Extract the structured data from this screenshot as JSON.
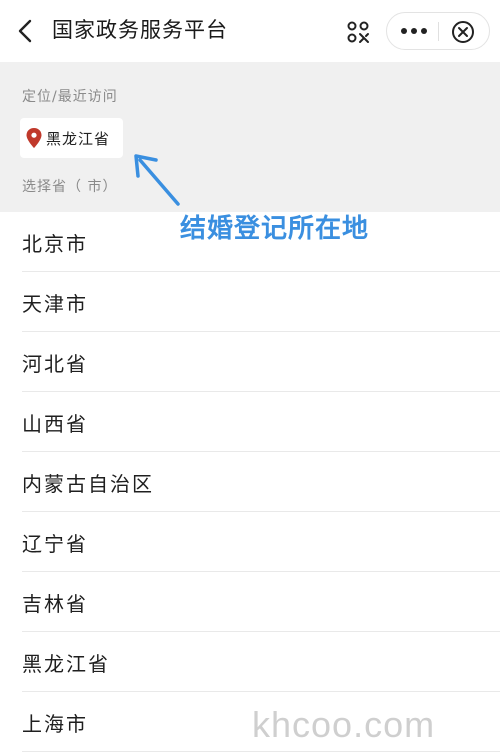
{
  "header": {
    "title": "国家政务服务平台",
    "back_icon": "chevron-left-icon",
    "scan_icon": "scan-icon",
    "more_icon": "more-dots-icon",
    "close_icon": "close-circle-icon"
  },
  "location": {
    "recent_label": "定位/最近访问",
    "current_province": "黑龙江省",
    "pin_color": "#c0392b",
    "select_label": "选择省（ 市）"
  },
  "annotation": {
    "text": "结婚登记所在地",
    "color": "#3a8fe0"
  },
  "provinces": [
    "北京市",
    "天津市",
    "河北省",
    "山西省",
    "内蒙古自治区",
    "辽宁省",
    "吉林省",
    "黑龙江省",
    "上海市"
  ],
  "watermark": "khcoo.com"
}
